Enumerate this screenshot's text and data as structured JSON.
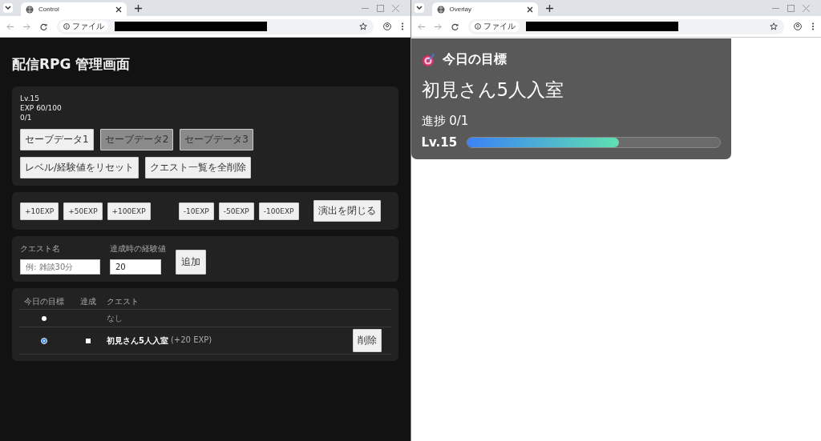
{
  "control_window": {
    "tab_title": "Control",
    "address_label": "ファイル",
    "page": {
      "title": "配信RPG 管理画面",
      "status_lines": [
        "Lv.15",
        "EXP 60/100",
        "0/1"
      ],
      "save_slots": [
        {
          "label": "セーブデータ1",
          "selected": true
        },
        {
          "label": "セーブデータ2",
          "selected": false
        },
        {
          "label": "セーブデータ3",
          "selected": false
        }
      ],
      "reset_buttons": [
        "レベル/経験値をリセット",
        "クエスト一覧を全削除"
      ],
      "exp_plus_buttons": [
        "+10EXP",
        "+50EXP",
        "+100EXP"
      ],
      "exp_minus_buttons": [
        "-10EXP",
        "-50EXP",
        "-100EXP"
      ],
      "close_effect_button": "演出を閉じる",
      "quest_form": {
        "name_label": "クエスト名",
        "name_placeholder": "例: 雑談30分",
        "exp_label": "達成時の経験値",
        "exp_value": "20",
        "add_button": "追加"
      },
      "quest_table": {
        "columns": [
          "今日の目標",
          "達成",
          "クエスト"
        ],
        "rows": [
          {
            "kind": "none",
            "selected": false,
            "name": "なし"
          },
          {
            "kind": "quest",
            "selected": true,
            "checked": false,
            "name": "初見さん5人入室",
            "exp": "(+20 EXP)",
            "delete_button": "削除"
          }
        ]
      }
    }
  },
  "overlay_window": {
    "tab_title": "Overlay",
    "address_label": "ファイル",
    "card": {
      "heading": "今日の目標",
      "goal": "初見さん5人入室",
      "progress": "進捗 0/1",
      "level_label": "Lv.15",
      "level": 0.6
    }
  }
}
